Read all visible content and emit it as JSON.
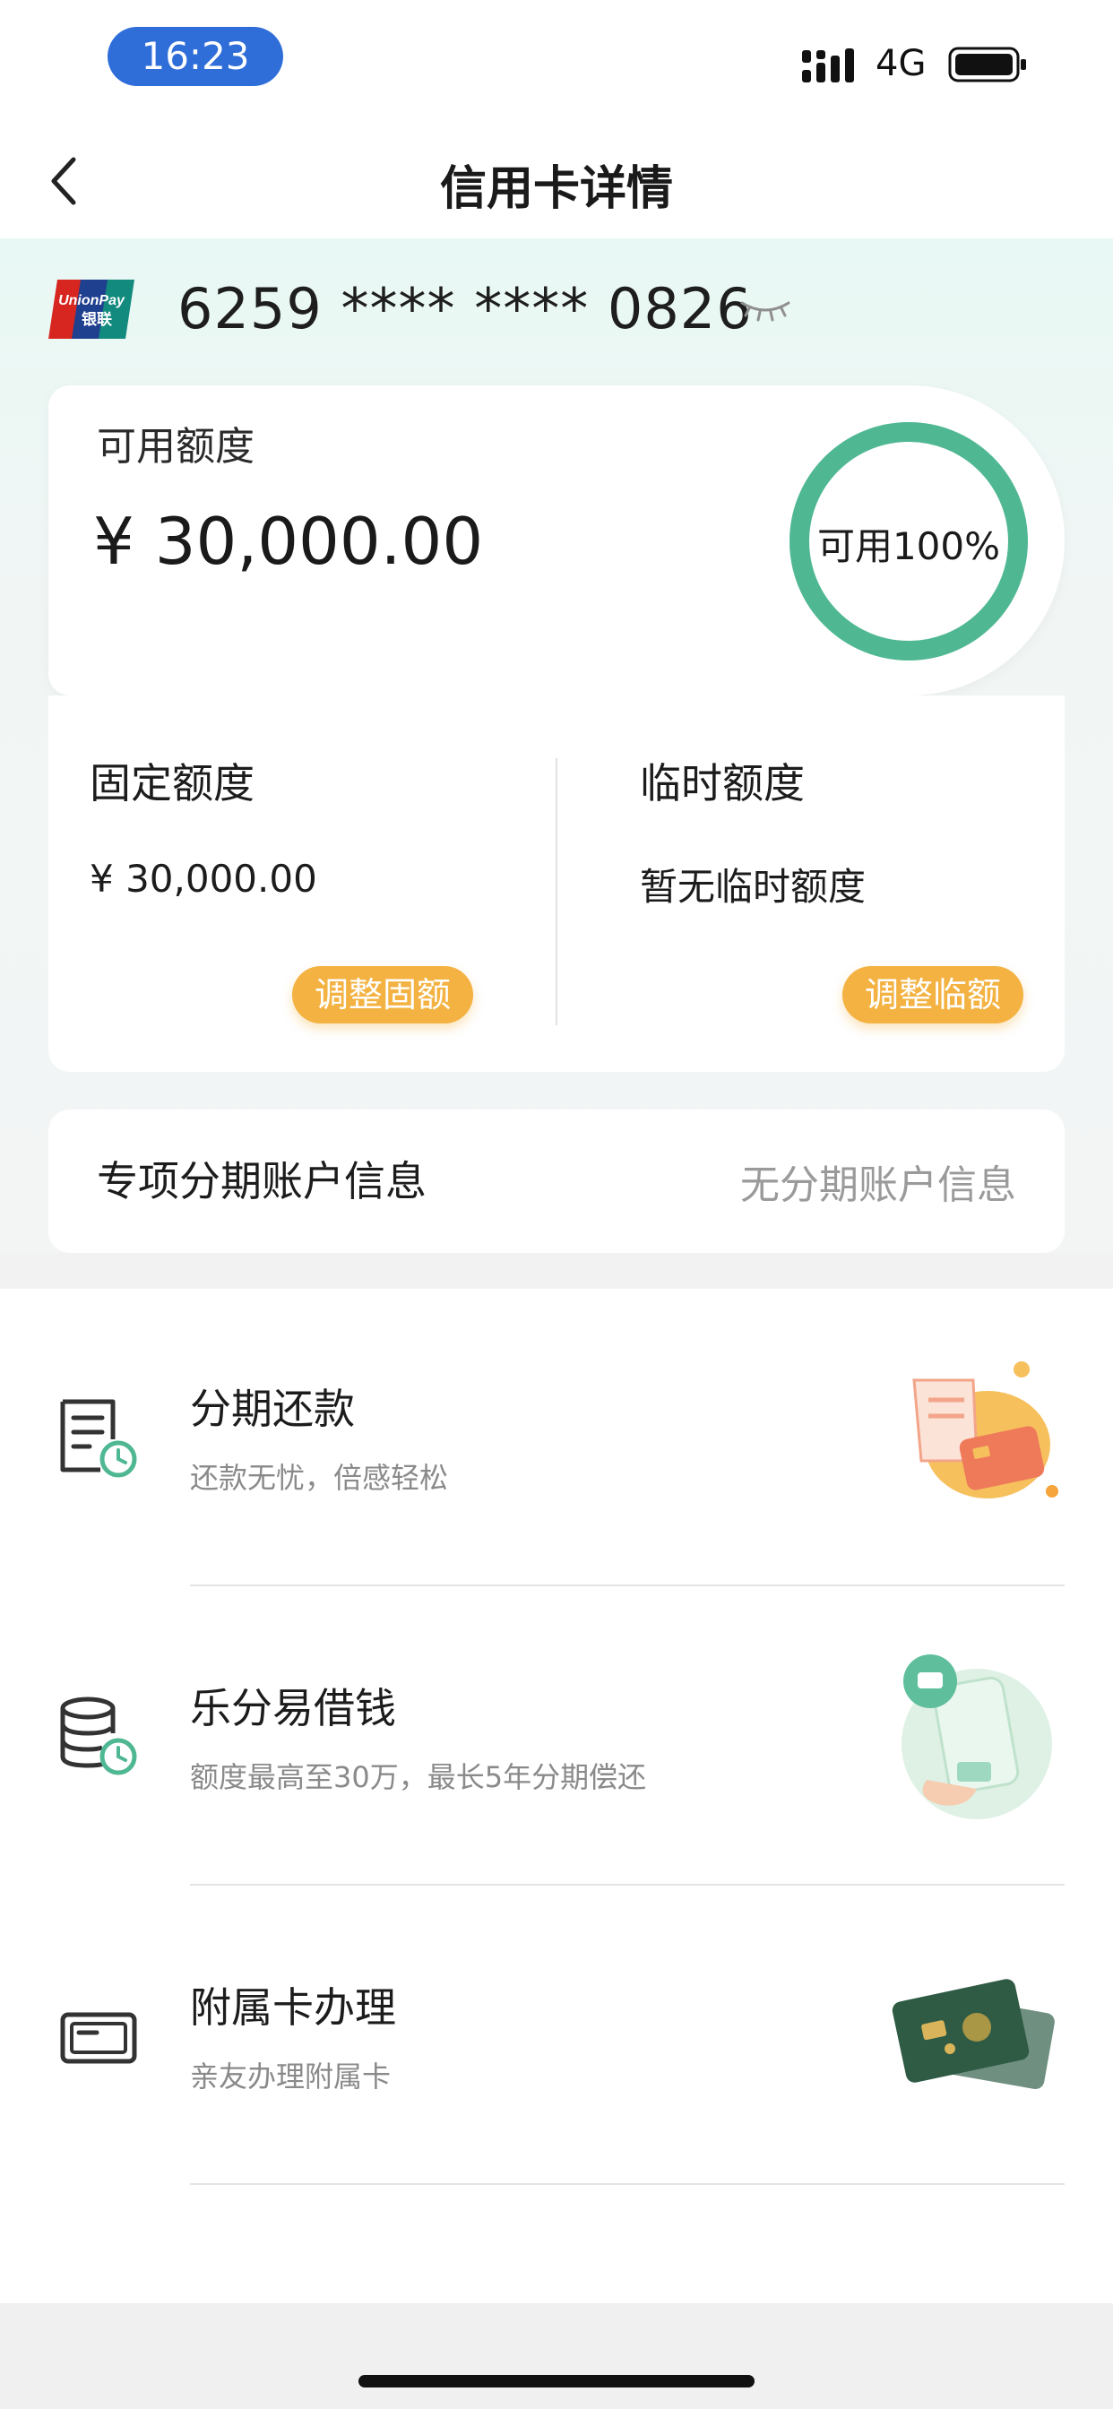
{
  "status_bar": {
    "time": "16:23",
    "network": "4G"
  },
  "nav": {
    "title": "信用卡详情"
  },
  "card": {
    "number": "6259 **** **** 0826",
    "brand_text_1": "UnionPay",
    "brand_text_2": "银联"
  },
  "available": {
    "label": "可用额度",
    "amount": "¥ 30,000.00",
    "ring_text": "可用100%",
    "ring_percent": 100
  },
  "fixed": {
    "label": "固定额度",
    "amount": "¥ 30,000.00",
    "button": "调整固额"
  },
  "temporary": {
    "label": "临时额度",
    "value": "暂无临时额度",
    "button": "调整临额"
  },
  "installment_account": {
    "label": "专项分期账户信息",
    "value": "无分期账户信息"
  },
  "services": [
    {
      "title": "分期还款",
      "subtitle": "还款无忧，倍感轻松",
      "icon": "bill-clock-icon"
    },
    {
      "title": "乐分易借钱",
      "subtitle": "额度最高至30万，最长5年分期偿还",
      "icon": "coins-clock-icon"
    },
    {
      "title": "附属卡办理",
      "subtitle": "亲友办理附属卡",
      "icon": "card-icon"
    }
  ],
  "colors": {
    "accent_green": "#4fb892",
    "orange": "#f3b241",
    "time_pill": "#2f6ed8"
  }
}
